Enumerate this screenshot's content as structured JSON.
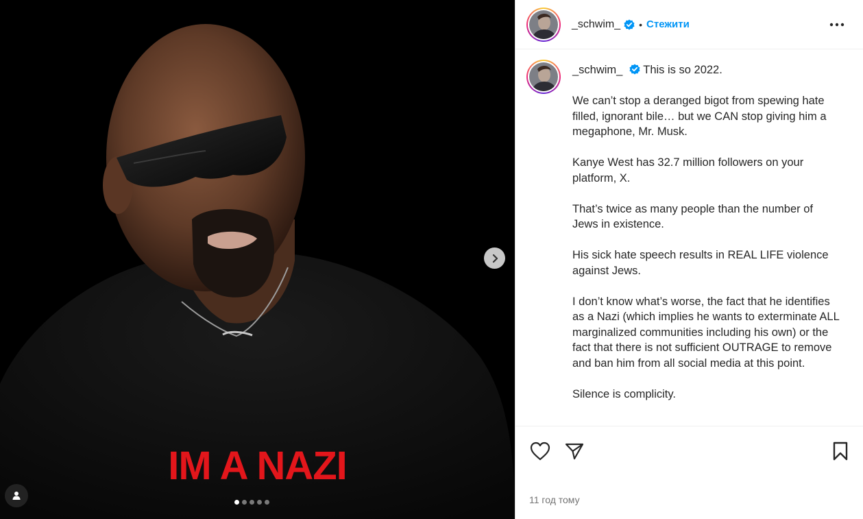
{
  "post": {
    "overlay_text": "IM A NAZI",
    "carousel": {
      "count": 5,
      "active_index": 0
    }
  },
  "header": {
    "username": "_schwim_",
    "separator": "•",
    "follow_label": "Стежити"
  },
  "caption": {
    "username": "_schwim_",
    "paragraphs": [
      "This is so 2022.",
      "We can’t stop a deranged bigot from spewing hate filled, ignorant bile… but we CAN stop giving him a megaphone, Mr. Musk.",
      "Kanye West has 32.7 million followers on your platform, X.",
      "That’s twice as many people than the number of Jews in existence.",
      "His sick hate speech results in REAL LIFE violence against Jews.",
      "I don’t know what’s worse, the fact that he identifies as a Nazi (which implies he wants to exterminate ALL marginalized communities including his own) or the fact that there is not sufficient OUTRAGE to remove and ban him from all social media at this point.",
      "Silence is complicity."
    ]
  },
  "footer": {
    "timestamp": "11 год тому"
  },
  "icons": {
    "verified": "verified-badge-icon",
    "more": "more-options-icon",
    "like": "heart-icon",
    "share": "paper-plane-icon",
    "save": "bookmark-icon",
    "next": "chevron-right-icon",
    "tag": "user-tag-icon"
  },
  "colors": {
    "follow": "#0095f6",
    "verified": "#0095f6",
    "overlay_text": "#e3161b"
  }
}
